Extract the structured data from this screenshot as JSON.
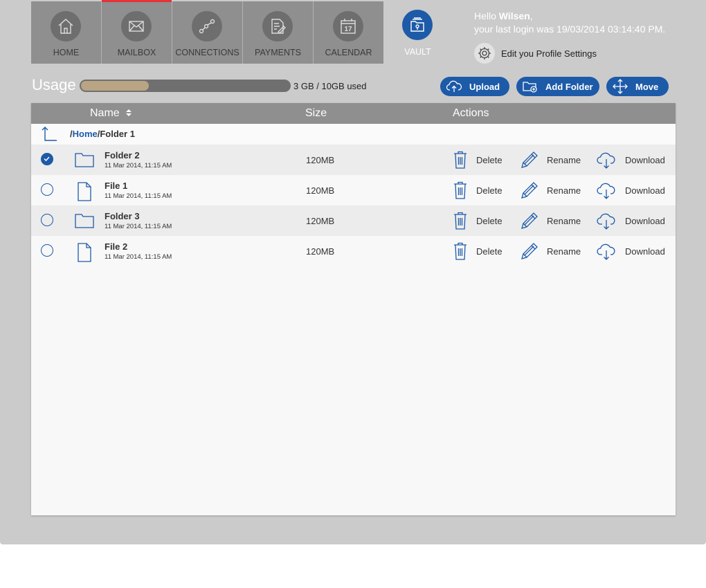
{
  "nav": {
    "tabs": [
      {
        "label": "HOME",
        "icon": "home-icon"
      },
      {
        "label": "MAILBOX",
        "icon": "mail-icon"
      },
      {
        "label": "CONNECTIONS",
        "icon": "connections-icon"
      },
      {
        "label": "PAYMENTS",
        "icon": "payments-icon"
      },
      {
        "label": "CALENDAR",
        "icon": "calendar-icon",
        "day": "17"
      }
    ],
    "vault_label": "VAULT"
  },
  "user": {
    "hello": "Hello",
    "name": "Wilsen",
    "comma": ",",
    "last_login": "your last login was  19/03/2014   03:14:40 PM.",
    "profile_link": "Edit you Profile Settings"
  },
  "usage": {
    "label": "Usage",
    "text": "3 GB / 10GB used",
    "fraction": 0.3
  },
  "toolbar": {
    "upload": "Upload",
    "add_folder": "Add Folder",
    "move": "Move"
  },
  "table": {
    "col_name": "Name",
    "sort_icon": "sort-icon",
    "col_size": "Size",
    "col_actions": "Actions",
    "path_prefix": "/",
    "path_home": "Home",
    "path_rest": "/Folder 1",
    "action_delete": "Delete",
    "action_rename": "Rename",
    "action_download": "Download",
    "rows": [
      {
        "name": "Folder 2",
        "date": "11 Mar 2014, 11:15 AM",
        "size": "120MB",
        "type": "folder",
        "selected": true
      },
      {
        "name": "File 1",
        "date": "11 Mar 2014, 11:15 AM",
        "size": "120MB",
        "type": "file",
        "selected": false
      },
      {
        "name": "Folder 3",
        "date": "11 Mar 2014, 11:15 AM",
        "size": "120MB",
        "type": "folder",
        "selected": false
      },
      {
        "name": "File 2",
        "date": "11 Mar 2014, 11:15 AM",
        "size": "120MB",
        "type": "file",
        "selected": false
      }
    ]
  },
  "colors": {
    "accent": "#1d5aa8",
    "active_tab_marker": "#e53238",
    "usage_fill": "#b9a483"
  }
}
